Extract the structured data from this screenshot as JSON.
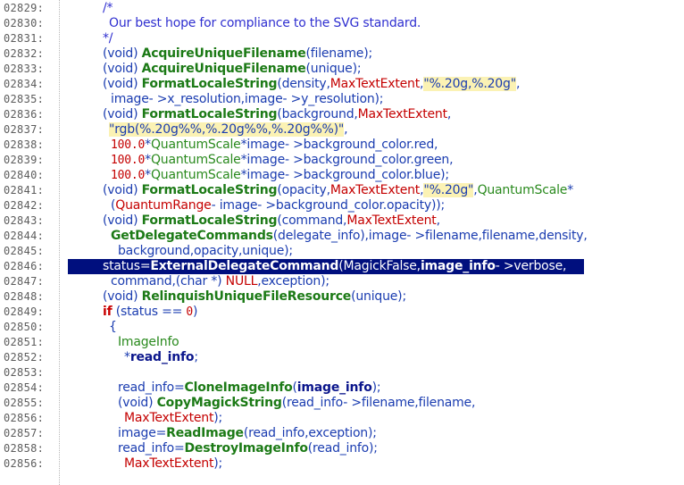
{
  "editor": {
    "selected_line": "02846",
    "lines": [
      {
        "num": "02829:",
        "indent": 115,
        "tokens": [
          {
            "t": "/*",
            "k": "comment"
          }
        ]
      },
      {
        "num": "02830:",
        "indent": 122,
        "tokens": [
          {
            "t": "Our best hope for compliance to the SVG standard.",
            "k": "comment"
          }
        ]
      },
      {
        "num": "02831:",
        "indent": 115,
        "tokens": [
          {
            "t": "*/",
            "k": "comment"
          }
        ]
      },
      {
        "num": "02832:",
        "indent": 115,
        "tokens": [
          {
            "t": "(void) ",
            "k": "plain"
          },
          {
            "t": "AcquireUniqueFilename",
            "k": "func"
          },
          {
            "t": "(filename);",
            "k": "plain"
          }
        ]
      },
      {
        "num": "02833:",
        "indent": 115,
        "tokens": [
          {
            "t": "(void) ",
            "k": "plain"
          },
          {
            "t": "AcquireUniqueFilename",
            "k": "func"
          },
          {
            "t": "(unique);",
            "k": "plain"
          }
        ]
      },
      {
        "num": "02834:",
        "indent": 115,
        "tokens": [
          {
            "t": "(void) ",
            "k": "plain"
          },
          {
            "t": "FormatLocaleString",
            "k": "func"
          },
          {
            "t": "(density,",
            "k": "plain"
          },
          {
            "t": "MaxTextExtent",
            "k": "red"
          },
          {
            "t": ",",
            "k": "plain"
          },
          {
            "t": "\"%.20g,%.20g\"",
            "k": "string"
          },
          {
            "t": ",",
            "k": "plain"
          }
        ]
      },
      {
        "num": "02835:",
        "indent": 124,
        "tokens": [
          {
            "t": "image- >x_resolution,image- >y_resolution);",
            "k": "plain"
          }
        ]
      },
      {
        "num": "02836:",
        "indent": 115,
        "tokens": [
          {
            "t": "(void) ",
            "k": "plain"
          },
          {
            "t": "FormatLocaleString",
            "k": "func"
          },
          {
            "t": "(background,",
            "k": "plain"
          },
          {
            "t": "MaxTextExtent",
            "k": "red"
          },
          {
            "t": ",",
            "k": "plain"
          }
        ]
      },
      {
        "num": "02837:",
        "indent": 122,
        "tokens": [
          {
            "t": "\"rgb(%.20g%%,%.20g%%,%.20g%%)\"",
            "k": "string"
          },
          {
            "t": ",",
            "k": "plain"
          }
        ]
      },
      {
        "num": "02838:",
        "indent": 124,
        "tokens": [
          {
            "t": "100.0",
            "k": "number"
          },
          {
            "t": "*",
            "k": "plain"
          },
          {
            "t": "QuantumScale",
            "k": "green"
          },
          {
            "t": "*image- >background_color.red,",
            "k": "plain"
          }
        ]
      },
      {
        "num": "02839:",
        "indent": 124,
        "tokens": [
          {
            "t": "100.0",
            "k": "number"
          },
          {
            "t": "*",
            "k": "plain"
          },
          {
            "t": "QuantumScale",
            "k": "green"
          },
          {
            "t": "*image- >background_color.green,",
            "k": "plain"
          }
        ]
      },
      {
        "num": "02840:",
        "indent": 124,
        "tokens": [
          {
            "t": "100.0",
            "k": "number"
          },
          {
            "t": "*",
            "k": "plain"
          },
          {
            "t": "QuantumScale",
            "k": "green"
          },
          {
            "t": "*image- >background_color.blue);",
            "k": "plain"
          }
        ]
      },
      {
        "num": "02841:",
        "indent": 115,
        "tokens": [
          {
            "t": "(void) ",
            "k": "plain"
          },
          {
            "t": "FormatLocaleString",
            "k": "func"
          },
          {
            "t": "(opacity,",
            "k": "plain"
          },
          {
            "t": "MaxTextExtent",
            "k": "red"
          },
          {
            "t": ",",
            "k": "plain"
          },
          {
            "t": "\"%.20g\"",
            "k": "string"
          },
          {
            "t": ",",
            "k": "plain"
          },
          {
            "t": "QuantumScale",
            "k": "green"
          },
          {
            "t": "*",
            "k": "plain"
          }
        ]
      },
      {
        "num": "02842:",
        "indent": 124,
        "tokens": [
          {
            "t": "(",
            "k": "plain"
          },
          {
            "t": "QuantumRange",
            "k": "red"
          },
          {
            "t": "- image- >background_color.opacity));",
            "k": "plain"
          }
        ]
      },
      {
        "num": "02843:",
        "indent": 115,
        "tokens": [
          {
            "t": "(void) ",
            "k": "plain"
          },
          {
            "t": "FormatLocaleString",
            "k": "func"
          },
          {
            "t": "(command,",
            "k": "plain"
          },
          {
            "t": "MaxTextExtent",
            "k": "red"
          },
          {
            "t": ",",
            "k": "plain"
          }
        ]
      },
      {
        "num": "02844:",
        "indent": 124,
        "tokens": [
          {
            "t": "GetDelegateCommands",
            "k": "func"
          },
          {
            "t": "(delegate_info),image- >filename,filename,density,",
            "k": "plain"
          }
        ]
      },
      {
        "num": "02845:",
        "indent": 132,
        "tokens": [
          {
            "t": "background,opacity,unique);",
            "k": "plain"
          }
        ]
      },
      {
        "num": "02846:",
        "indent": 115,
        "tokens": [
          {
            "t": "status=",
            "k": "plain"
          },
          {
            "t": "ExternalDelegateCommand",
            "k": "func"
          },
          {
            "t": "(MagickFalse,",
            "k": "plain"
          },
          {
            "t": "image_info",
            "k": "bold"
          },
          {
            "t": "- >verbose,",
            "k": "plain"
          }
        ]
      },
      {
        "num": "02847:",
        "indent": 124,
        "tokens": [
          {
            "t": "command,(char *) ",
            "k": "plain"
          },
          {
            "t": "NULL",
            "k": "red"
          },
          {
            "t": ",exception);",
            "k": "plain"
          }
        ]
      },
      {
        "num": "02848:",
        "indent": 115,
        "tokens": [
          {
            "t": "(void) ",
            "k": "plain"
          },
          {
            "t": "RelinquishUniqueFileResource",
            "k": "func"
          },
          {
            "t": "(unique);",
            "k": "plain"
          }
        ]
      },
      {
        "num": "02849:",
        "indent": 115,
        "tokens": [
          {
            "t": "if",
            "k": "keyword"
          },
          {
            "t": " (status == ",
            "k": "plain"
          },
          {
            "t": "0",
            "k": "number"
          },
          {
            "t": ")",
            "k": "plain"
          }
        ]
      },
      {
        "num": "02850:",
        "indent": 122,
        "tokens": [
          {
            "t": "{",
            "k": "plain"
          }
        ]
      },
      {
        "num": "02851:",
        "indent": 132,
        "tokens": [
          {
            "t": "ImageInfo",
            "k": "green"
          }
        ]
      },
      {
        "num": "02852:",
        "indent": 139,
        "tokens": [
          {
            "t": "*",
            "k": "plain"
          },
          {
            "t": "read_info",
            "k": "bold"
          },
          {
            "t": ";",
            "k": "plain"
          }
        ]
      },
      {
        "num": "02853:",
        "indent": 132,
        "tokens": []
      },
      {
        "num": "02854:",
        "indent": 132,
        "tokens": [
          {
            "t": "read_info=",
            "k": "plain"
          },
          {
            "t": "CloneImageInfo",
            "k": "func"
          },
          {
            "t": "(",
            "k": "plain"
          },
          {
            "t": "image_info",
            "k": "bold"
          },
          {
            "t": ");",
            "k": "plain"
          }
        ]
      },
      {
        "num": "02855:",
        "indent": 132,
        "tokens": [
          {
            "t": "(void) ",
            "k": "plain"
          },
          {
            "t": "CopyMagickString",
            "k": "func"
          },
          {
            "t": "(read_info- >filename,filename,",
            "k": "plain"
          }
        ]
      },
      {
        "num": "02856:",
        "indent": 139,
        "tokens": [
          {
            "t": "MaxTextExtent",
            "k": "red"
          },
          {
            "t": ");",
            "k": "plain"
          }
        ]
      },
      {
        "num": "02857:",
        "indent": 132,
        "tokens": [
          {
            "t": "image=",
            "k": "plain"
          },
          {
            "t": "ReadImage",
            "k": "func"
          },
          {
            "t": "(read_info,exception);",
            "k": "plain"
          }
        ]
      },
      {
        "num": "02858:",
        "indent": 132,
        "tokens": [
          {
            "t": "read_info=",
            "k": "plain"
          },
          {
            "t": "DestroyImageInfo",
            "k": "func"
          },
          {
            "t": "(read_info);",
            "k": "plain"
          }
        ]
      },
      {
        "num": "02856:",
        "indent": 139,
        "tokens": [
          {
            "t": "MaxTextExtent",
            "k": "red"
          },
          {
            "t": ");",
            "k": "plain"
          }
        ]
      }
    ]
  }
}
